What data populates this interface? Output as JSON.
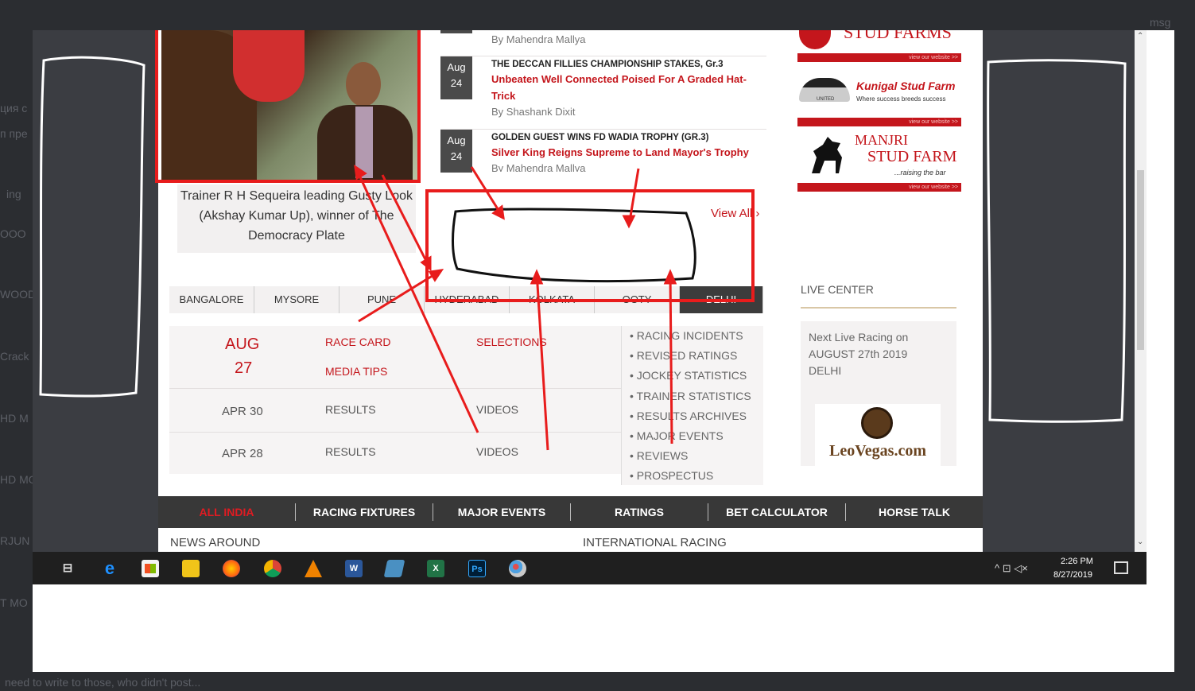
{
  "background_chat": {
    "fragments": [
      "ция с",
      "п пре",
      "ing",
      "ООО",
      "WOOD",
      "Crack",
      "HD M",
      "HD MO",
      "RJUN",
      "T MO",
      "msg",
      "need to write to those, who didn't post..."
    ]
  },
  "browser": {
    "caption": "Trainer R H Sequeira leading Gusty Look (Akshay Kumar Up), winner of The Democracy Plate",
    "news": [
      {
        "month": "",
        "day": "",
        "headline": "",
        "subhead": "",
        "byline": "By Mahendra Mallya"
      },
      {
        "month": "Aug",
        "day": "24",
        "headline": "THE DECCAN FILLIES CHAMPIONSHIP STAKES, Gr.3",
        "subhead": "Unbeaten Well Connected Poised For A Graded Hat-Trick",
        "byline": "By Shashank Dixit"
      },
      {
        "month": "Aug",
        "day": "24",
        "headline": "GOLDEN GUEST WINS FD WADIA TROPHY (GR.3)",
        "subhead": "Silver King Reigns Supreme to Land Mayor's Trophy",
        "byline": "By Mahendra Mallya"
      }
    ],
    "view_all": "View All ›",
    "tabs": [
      "BANGALORE",
      "MYSORE",
      "PUNE",
      "HYDERABAD",
      "KOLKATA",
      "OOTY",
      "DELHI"
    ],
    "race_rows": [
      {
        "date_month": "AUG",
        "date_day": "27",
        "col1a": "RACE CARD",
        "col1b": "MEDIA TIPS",
        "col2": "SELECTIONS"
      },
      {
        "date_month": "APR",
        "date_day": "30",
        "col1a": "RESULTS",
        "col2": "VIDEOS"
      },
      {
        "date_month": "APR",
        "date_day": "28",
        "col1a": "RESULTS",
        "col2": "VIDEOS"
      }
    ],
    "side_links": [
      "• RACING INCIDENTS",
      "• REVISED RATINGS",
      "• JOCKEY STATISTICS",
      "• TRAINER STATISTICS",
      "• RESULTS ARCHIVES",
      "• MAJOR EVENTS",
      "• REVIEWS",
      "• PROSPECTUS"
    ],
    "ads": {
      "stud_farms": "STUD FARMS",
      "view_site": "view our website >>",
      "kunigal_title": "Kunigal Stud Farm",
      "kunigal_tagline": "Where success breeds success",
      "kunigal_logo": "UNITED",
      "manjri_title1": "MANJRI",
      "manjri_title2": "STUD FARM",
      "manjri_tagline": "...raising the bar"
    },
    "live_center": {
      "title": "LIVE CENTER",
      "text": "Next Live Racing on AUGUST 27th 2019 DELHI",
      "sponsor": "LeoVegas.com"
    },
    "nav": [
      "ALL INDIA",
      "RACING FIXTURES",
      "MAJOR EVENTS",
      "RATINGS",
      "BET CALCULATOR",
      "HORSE TALK"
    ],
    "footer": {
      "left": "NEWS AROUND",
      "right": "INTERNATIONAL RACING"
    }
  },
  "taskbar": {
    "time": "2:26 PM",
    "date": "8/27/2019",
    "icons": [
      "task-view-icon",
      "edge-icon",
      "store-icon",
      "file-explorer-icon",
      "firefox-icon",
      "chrome-icon",
      "vlc-icon",
      "word-icon",
      "app-icon",
      "excel-icon",
      "photoshop-icon",
      "paint-icon"
    ],
    "ps_label": "Ps"
  },
  "colors": {
    "accent_red": "#c4161c",
    "annotation_red": "#e81c1c",
    "dark_bg": "#2b2d31"
  }
}
